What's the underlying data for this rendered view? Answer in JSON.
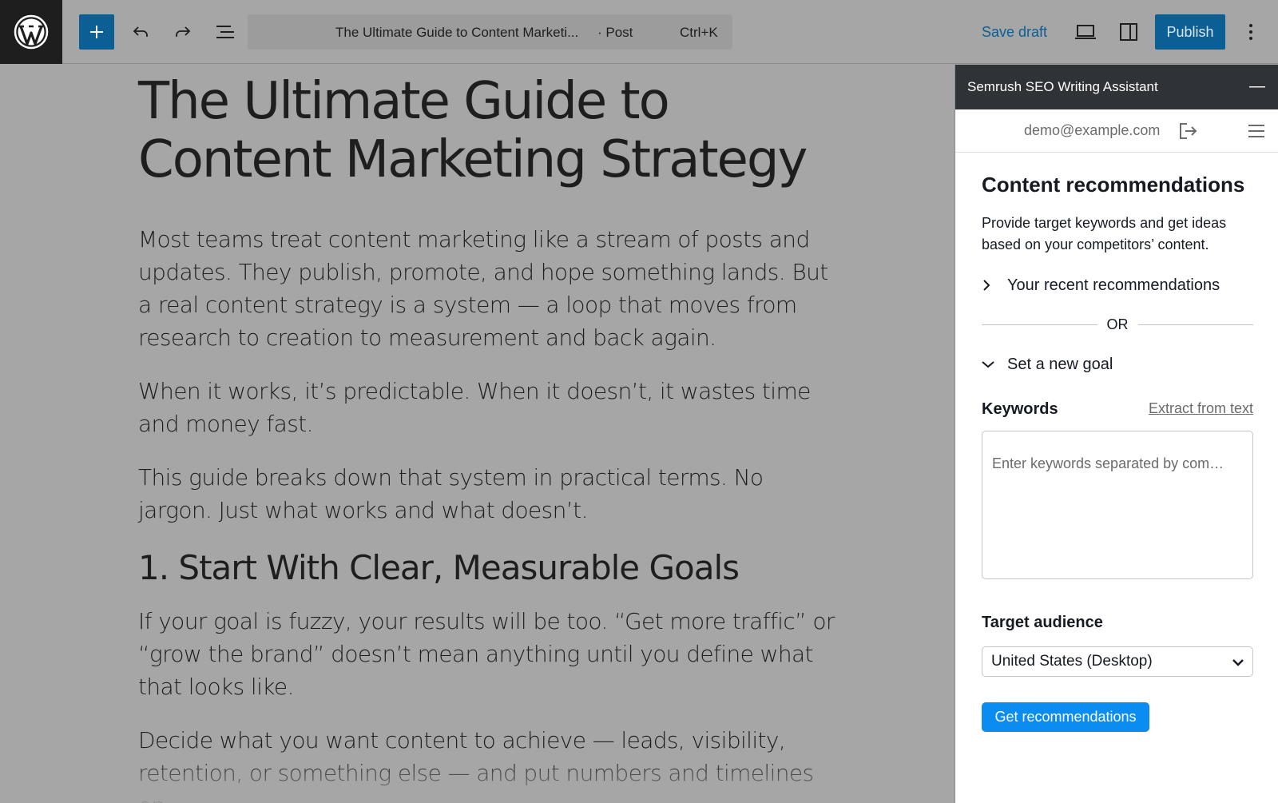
{
  "toolbar": {
    "command_title": "The Ultimate Guide to Content Marketi...",
    "command_type": "· Post",
    "command_shortcut": "Ctrl+K",
    "save_draft_label": "Save draft",
    "publish_label": "Publish"
  },
  "post": {
    "title": "The Ultimate Guide to Content Marketing Strategy",
    "paragraphs": [
      "Most teams treat content marketing like a stream of posts and updates. They publish, promote, and hope something lands. But a real content strategy is a system — a loop that moves from research to creation to measurement and back again.",
      "When it works, it’s predictable. When it doesn’t, it wastes time and money fast.",
      "This guide breaks down that system in practical terms. No jargon. Just what works and what doesn’t."
    ],
    "heading_1": "1. Start With Clear, Measurable Goals",
    "paragraphs_after": [
      "If your goal is fuzzy, your results will be too. “Get more traffic” or “grow the brand” doesn’t mean anything until you define what that looks like.",
      "Decide what you want content to achieve — leads, visibility, retention, or something else — and put numbers and timelines on"
    ]
  },
  "panel": {
    "header_title": "Semrush SEO Writing Assistant",
    "minimize_glyph": "—",
    "account_email": "demo@example.com",
    "section_title": "Content recommendations",
    "section_description": "Provide target keywords and get ideas based on your competitors’ content.",
    "recent_label": "Your recent recommendations",
    "or_label": "OR",
    "new_goal_label": "Set a new goal",
    "keywords_label": "Keywords",
    "extract_label": "Extract from text",
    "keywords_placeholder": "Enter keywords separated by com…",
    "audience_label": "Target audience",
    "audience_selected": "United States (Desktop)",
    "get_button_label": "Get recommendations"
  },
  "colors": {
    "accent": "#0b5f95",
    "semrush_button": "#0a8cf0",
    "panel_header": "#2f3237",
    "overlay_gray": "#a6a6a6"
  },
  "icons": [
    "wordpress-logo-icon",
    "plus-icon",
    "undo-icon",
    "redo-icon",
    "list-view-icon",
    "preview-icon",
    "sidebar-toggle-icon",
    "more-vertical-icon",
    "logout-icon",
    "hamburger-menu-icon",
    "chevron-right-icon",
    "chevron-down-icon"
  ]
}
